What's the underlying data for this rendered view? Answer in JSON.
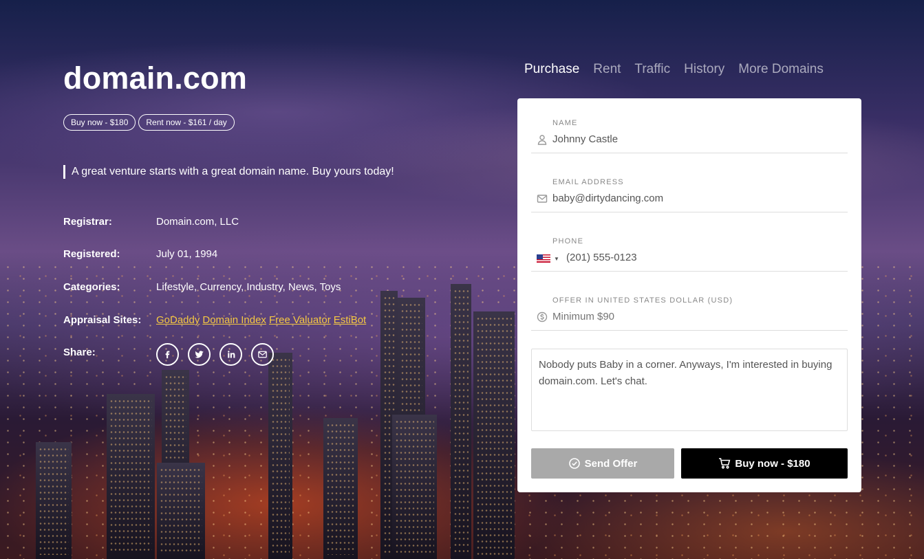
{
  "domain": "domain.com",
  "pills": {
    "buy": "Buy now - $180",
    "rent": "Rent now - $161 / day"
  },
  "tagline": "A great venture starts with a great domain name. Buy yours today!",
  "info": {
    "registrar_label": "Registrar:",
    "registrar_value": "Domain.com, LLC",
    "registered_label": "Registered:",
    "registered_value": "July 01, 1994",
    "categories_label": "Categories:",
    "categories_value": "Lifestyle, Currency, Industry, News, Toys",
    "appraisal_label": "Appraisal Sites:",
    "appraisal_links": [
      "GoDaddy",
      "Domain Index",
      "Free Valuator",
      "EstiBot"
    ],
    "share_label": "Share:",
    "share_icons": [
      "facebook-icon",
      "twitter-icon",
      "linkedin-icon",
      "email-icon"
    ]
  },
  "nav": {
    "tabs": [
      "Purchase",
      "Rent",
      "Traffic",
      "History",
      "More Domains"
    ],
    "active": "Purchase"
  },
  "form": {
    "name_label": "NAME",
    "name_value": "Johnny Castle",
    "email_label": "EMAIL ADDRESS",
    "email_value": "baby@dirtydancing.com",
    "phone_label": "PHONE",
    "phone_value": "(201) 555-0123",
    "phone_country": "us-flag-icon",
    "offer_label": "OFFER IN UNITED STATES DOLLAR (USD)",
    "offer_placeholder": "Minimum $90",
    "message": "Nobody puts Baby in a corner. Anyways, I'm interested in buying domain.com. Let's chat.",
    "send_label": "Send Offer",
    "buy_label": "Buy now - $180"
  },
  "colors": {
    "link": "#f5c842",
    "send_button": "#a9a9a9",
    "buy_button": "#000000"
  }
}
